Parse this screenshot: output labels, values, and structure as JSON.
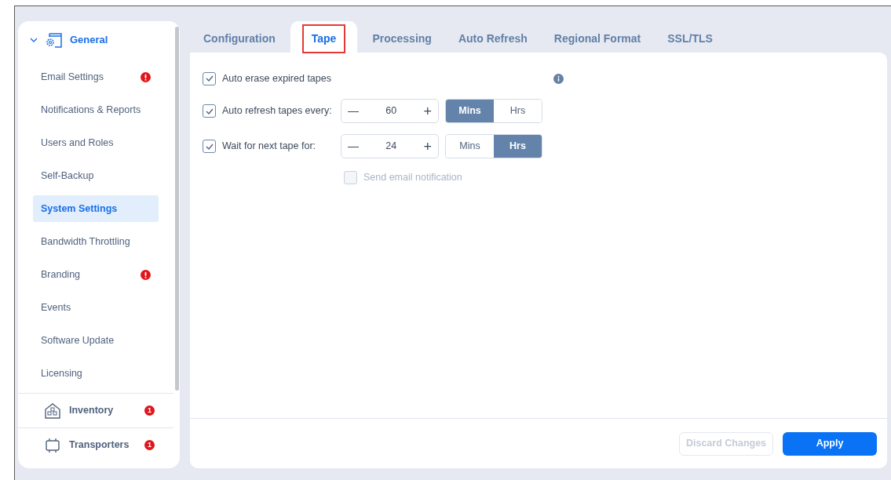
{
  "sidebar": {
    "section": {
      "label": "General",
      "expanded": true
    },
    "items": [
      {
        "label": "Email Settings",
        "selected": false,
        "alert": true
      },
      {
        "label": "Notifications & Reports",
        "selected": false,
        "alert": false
      },
      {
        "label": "Users and Roles",
        "selected": false,
        "alert": false
      },
      {
        "label": "Self-Backup",
        "selected": false,
        "alert": false
      },
      {
        "label": "System Settings",
        "selected": true,
        "alert": false
      },
      {
        "label": "Bandwidth Throttling",
        "selected": false,
        "alert": false
      },
      {
        "label": "Branding",
        "selected": false,
        "alert": true
      },
      {
        "label": "Events",
        "selected": false,
        "alert": false
      },
      {
        "label": "Software Update",
        "selected": false,
        "alert": false
      },
      {
        "label": "Licensing",
        "selected": false,
        "alert": false
      }
    ],
    "groups": [
      {
        "label": "Inventory",
        "kind": "inventory",
        "badge": "1"
      },
      {
        "label": "Transporters",
        "kind": "transporters",
        "badge": "1"
      }
    ]
  },
  "tabs": [
    {
      "label": "Configuration",
      "selected": false,
      "highlighted": false
    },
    {
      "label": "Tape",
      "selected": true,
      "highlighted": true
    },
    {
      "label": "Processing",
      "selected": false,
      "highlighted": false
    },
    {
      "label": "Auto Refresh",
      "selected": false,
      "highlighted": false
    },
    {
      "label": "Regional Format",
      "selected": false,
      "highlighted": false
    },
    {
      "label": "SSL/TLS",
      "selected": false,
      "highlighted": false
    }
  ],
  "options": [
    {
      "kind": "checkbox",
      "label": "Auto erase expired tapes",
      "checked": true,
      "info": true
    },
    {
      "kind": "spinner",
      "label": "Auto refresh tapes every:",
      "checked": true,
      "minus": "—",
      "value": "60",
      "plus": "+",
      "units": [
        {
          "label": "Mins",
          "selected": true
        },
        {
          "label": "Hrs",
          "selected": false
        }
      ]
    },
    {
      "kind": "spinner",
      "label": "Wait for next tape for:",
      "checked": true,
      "minus": "—",
      "value": "24",
      "plus": "+",
      "units": [
        {
          "label": "Mins",
          "selected": false
        },
        {
          "label": "Hrs",
          "selected": true
        }
      ]
    },
    {
      "kind": "sub",
      "label": "Send email notification",
      "checked": false,
      "disabled": true
    }
  ],
  "footer": {
    "buttons": [
      {
        "label": "Discard Changes",
        "disabled": true,
        "primary": false
      },
      {
        "label": "Apply",
        "disabled": false,
        "primary": true
      }
    ]
  }
}
